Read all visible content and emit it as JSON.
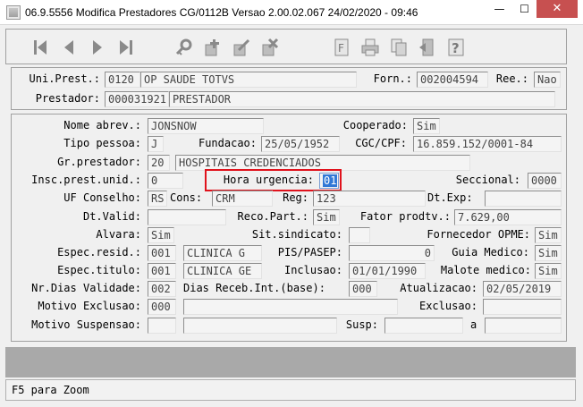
{
  "window": {
    "title": "06.9.5556   Modifica  Prestadores CG/0112B Versao 2.00.02.067 24/02/2020 - 09:46",
    "minimize": "—",
    "maximize": "☐",
    "close": "✕"
  },
  "toolbar": {
    "buttons": [
      {
        "name": "first-record-button",
        "icon": "first-icon"
      },
      {
        "name": "previous-record-button",
        "icon": "previous-icon"
      },
      {
        "name": "next-record-button",
        "icon": "next-icon"
      },
      {
        "name": "last-record-button",
        "icon": "last-icon"
      },
      {
        "name": "search-button",
        "icon": "search-key-icon"
      },
      {
        "name": "add-button",
        "icon": "add-icon"
      },
      {
        "name": "edit-button",
        "icon": "edit-icon"
      },
      {
        "name": "delete-button",
        "icon": "delete-icon"
      },
      {
        "name": "filter-button",
        "icon": "filter-icon"
      },
      {
        "name": "print-button",
        "icon": "printer-icon"
      },
      {
        "name": "copy-button",
        "icon": "copy-icon"
      },
      {
        "name": "exit-button",
        "icon": "exit-door-icon"
      },
      {
        "name": "help-button",
        "icon": "help-icon"
      }
    ]
  },
  "header": {
    "uni_prest_label": "Uni.Prest.:",
    "uni_prest_code": "0120",
    "uni_prest_name": "OP SAUDE TOTVS",
    "forn_label": "Forn.:",
    "forn_value": "002004594",
    "ree_label": "Ree.:",
    "ree_value": "Nao",
    "prestador_label": "Prestador:",
    "prestador_code": "000031921",
    "prestador_name": "PRESTADOR"
  },
  "form": {
    "nome_abrev_label": "Nome abrev.:",
    "nome_abrev": "JONSNOW",
    "cooperado_label": "Cooperado:",
    "cooperado": "Sim",
    "tipo_pessoa_label": "Tipo pessoa:",
    "tipo_pessoa": "J",
    "fundacao_label": "Fundacao:",
    "fundacao": "25/05/1952",
    "cgc_label": "CGC/CPF:",
    "cgc": "16.859.152/0001-84",
    "gr_prestador_label": "Gr.prestador:",
    "gr_prestador_code": "20",
    "gr_prestador_name": "HOSPITAIS CREDENCIADOS",
    "insc_label": "Insc.prest.unid.:",
    "insc": "0",
    "hora_urgencia_label": "Hora urgencia:",
    "hora_urgencia": "01",
    "seccional_label": "Seccional:",
    "seccional": "0000",
    "uf_conselho_label": "UF Conselho:",
    "uf_conselho": "RS",
    "cons_label": "Cons:",
    "cons": "CRM",
    "reg_label": "Reg:",
    "reg": "123",
    "dt_exp_label": "Dt.Exp:",
    "dt_exp": "",
    "dt_valid_label": "Dt.Valid:",
    "dt_valid": "",
    "reco_part_label": "Reco.Part.:",
    "reco_part": "Sim",
    "fator_label": "Fator prodtv.:",
    "fator": "7.629,00",
    "alvara_label": "Alvara:",
    "alvara": "Sim",
    "sit_sindicato_label": "Sit.sindicato:",
    "sit_sindicato": "",
    "fornecedor_opme_label": "Fornecedor OPME:",
    "fornecedor_opme": "Sim",
    "espec_resid_label": "Espec.resid.:",
    "espec_resid_code": "001",
    "espec_resid_name": "CLINICA G",
    "pis_label": "PIS/PASEP:",
    "pis": "0",
    "guia_medico_label": "Guia Medico:",
    "guia_medico": "Sim",
    "espec_titulo_label": "Espec.titulo:",
    "espec_titulo_code": "001",
    "espec_titulo_name": "CLINICA GE",
    "inclusao_label": "Inclusao:",
    "inclusao": "01/01/1990",
    "malote_label": "Malote medico:",
    "malote": "Sim",
    "nr_dias_label": "Nr.Dias Validade:",
    "nr_dias": "002",
    "dias_receb_label": "Dias Receb.Int.(base):",
    "dias_receb": "000",
    "atualizacao_label": "Atualizacao:",
    "atualizacao": "02/05/2019",
    "motivo_exclusao_label": "Motivo Exclusao:",
    "motivo_exclusao_code": "000",
    "motivo_exclusao_desc": "",
    "exclusao_label": "Exclusao:",
    "exclusao": "",
    "motivo_suspensao_label": "Motivo Suspensao:",
    "motivo_suspensao_code": "",
    "motivo_suspensao_desc": "",
    "susp_label": "Susp:",
    "susp_from": "",
    "a_label": "a",
    "susp_to": ""
  },
  "status": {
    "text": "F5 para Zoom"
  }
}
